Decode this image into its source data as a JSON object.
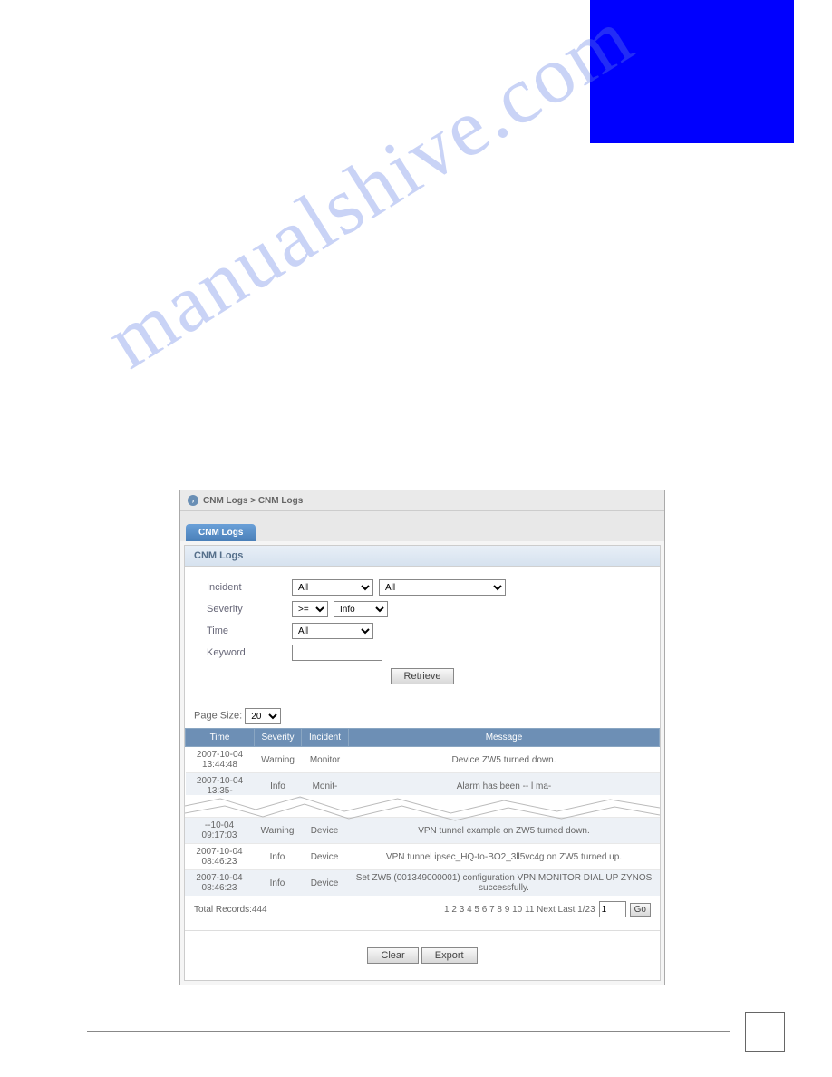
{
  "watermark": "manualshive.com",
  "breadcrumb": "CNM Logs > CNM Logs",
  "tab_label": "CNM Logs",
  "panel_title": "CNM Logs",
  "form": {
    "incident_label": "Incident",
    "incident_sel1": "All",
    "incident_sel2": "All",
    "severity_label": "Severity",
    "severity_op": ">=",
    "severity_val": "Info",
    "time_label": "Time",
    "time_val": "All",
    "keyword_label": "Keyword",
    "keyword_val": ""
  },
  "retrieve_btn": "Retrieve",
  "pagesize_label": "Page Size:",
  "pagesize_val": "20",
  "cols": {
    "time": "Time",
    "severity": "Severity",
    "incident": "Incident",
    "message": "Message"
  },
  "rows_top": [
    {
      "time": "2007-10-04 13:44:48",
      "severity": "Warning",
      "incident": "Monitor",
      "message": "Device ZW5 turned down."
    },
    {
      "time": "2007-10-04 13:35-",
      "severity": "Info",
      "incident": "Monit-",
      "message": "Alarm has been -- l ma-"
    }
  ],
  "rows_bottom": [
    {
      "time": "--10-04 09:17:03",
      "severity": "Warning",
      "incident": "Device",
      "message": "VPN tunnel example on ZW5 turned down."
    },
    {
      "time": "2007-10-04 08:46:23",
      "severity": "Info",
      "incident": "Device",
      "message": "VPN tunnel ipsec_HQ-to-BO2_3ll5vc4g on ZW5 turned up."
    },
    {
      "time": "2007-10-04 08:46:23",
      "severity": "Info",
      "incident": "Device",
      "message": "Set ZW5 (001349000001) configuration VPN MONITOR DIAL UP ZYNOS successfully."
    }
  ],
  "total_records": "Total Records:444",
  "pagination_text": "1 2 3 4 5 6 7 8 9 10 11 Next Last 1/23",
  "pagination_input": "1",
  "go_btn": "Go",
  "clear_btn": "Clear",
  "export_btn": "Export"
}
